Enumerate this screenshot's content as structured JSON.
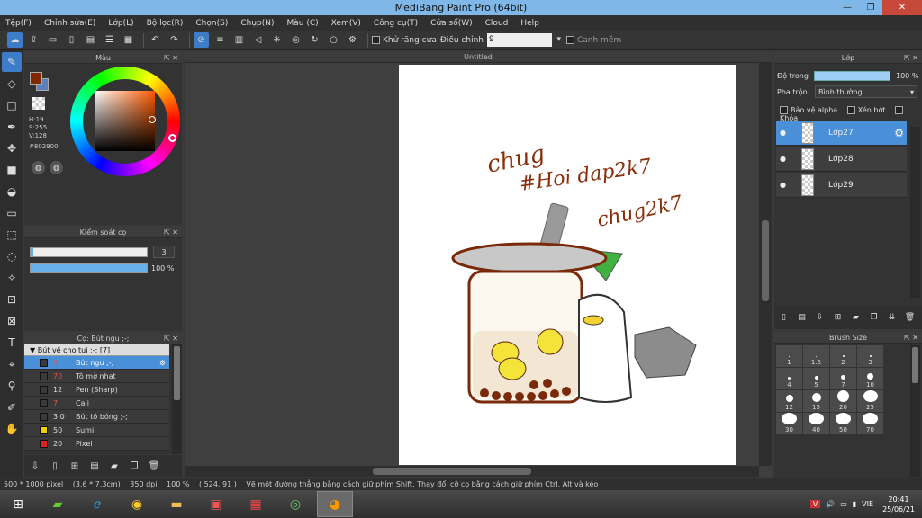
{
  "window": {
    "title": "MediBang Paint Pro (64bit)"
  },
  "menu": [
    "Tệp(F)",
    "Chỉnh sửa(E)",
    "Lớp(L)",
    "Bộ lọc(R)",
    "Chọn(S)",
    "Chụp(N)",
    "Màu (C)",
    "Xem(V)",
    "Công cụ(T)",
    "Cửa sổ(W)",
    "Cloud",
    "Help"
  ],
  "toolbar": {
    "antialias_label": "Khử răng cưa",
    "correction_label": "Điều chỉnh",
    "correction_value": "9",
    "snap_label": "Canh mềm"
  },
  "color_panel": {
    "title": "Màu",
    "h": "H:19",
    "s": "S:255",
    "v": "V:128",
    "hex": "#802900",
    "fg_color": "#802900",
    "bg_color": "#5b7fbf"
  },
  "brush_control": {
    "title": "Kiểm soát cọ",
    "size_value": "3",
    "opacity_value": "100 %",
    "size_fraction": 0.02,
    "opacity_fraction": 1.0
  },
  "brush_panel": {
    "title": "Cọ: Bút ngu ;-;",
    "group": "Bút vẽ cho tui ;-; [7]",
    "items": [
      {
        "value": "3",
        "name": "Bút ngu ;-;",
        "color": "#3a3a3a",
        "selected": true
      },
      {
        "value": "70",
        "name": "Tô mờ nhạt",
        "color": "#3a3a3a"
      },
      {
        "value": "12",
        "name": "Pen (Sharp)",
        "color": "#3a3a3a"
      },
      {
        "value": "7",
        "name": "Cali",
        "color": "#3a3a3a"
      },
      {
        "value": "3.0",
        "name": "Bút tô bóng ;-;",
        "color": "#3a3a3a"
      },
      {
        "value": "50",
        "name": "Sumi",
        "color": "#f0d000"
      },
      {
        "value": "20",
        "name": "Pixel",
        "color": "#e02020"
      }
    ]
  },
  "canvas": {
    "tab": "Untitled",
    "text1": "chug",
    "text2": "#Hoi dap2k7",
    "text3": "chug2k7"
  },
  "layers": {
    "title": "Lớp",
    "opacity_label": "Độ trong",
    "opacity_value": "100 %",
    "blend_label": "Pha trộn",
    "blend_value": "Bình thường",
    "protect_alpha": "Bảo vệ alpha",
    "clipping": "Xén bớt",
    "lock": "Khóa",
    "items": [
      "Lớp27",
      "Lớp28",
      "Lớp29"
    ]
  },
  "brush_size": {
    "title": "Brush Size",
    "sizes": [
      "1",
      "1.5",
      "2",
      "3",
      "4",
      "5",
      "7",
      "10",
      "12",
      "15",
      "20",
      "25",
      "30",
      "40",
      "50",
      "70"
    ]
  },
  "status": {
    "dims": "500 * 1000 pixel",
    "cm": "(3.6 * 7.3cm)",
    "dpi": "350 dpi",
    "zoom": "100 %",
    "coords": "( 524, 91 )",
    "hint": "Vẽ một đường thẳng bằng cách giữ phím Shift, Thay đổi cỡ cọ bằng cách giữ phím Ctrl, Alt và kéo"
  },
  "taskbar": {
    "lang": "VIE",
    "time": "20:41",
    "date": "25/06/21"
  }
}
